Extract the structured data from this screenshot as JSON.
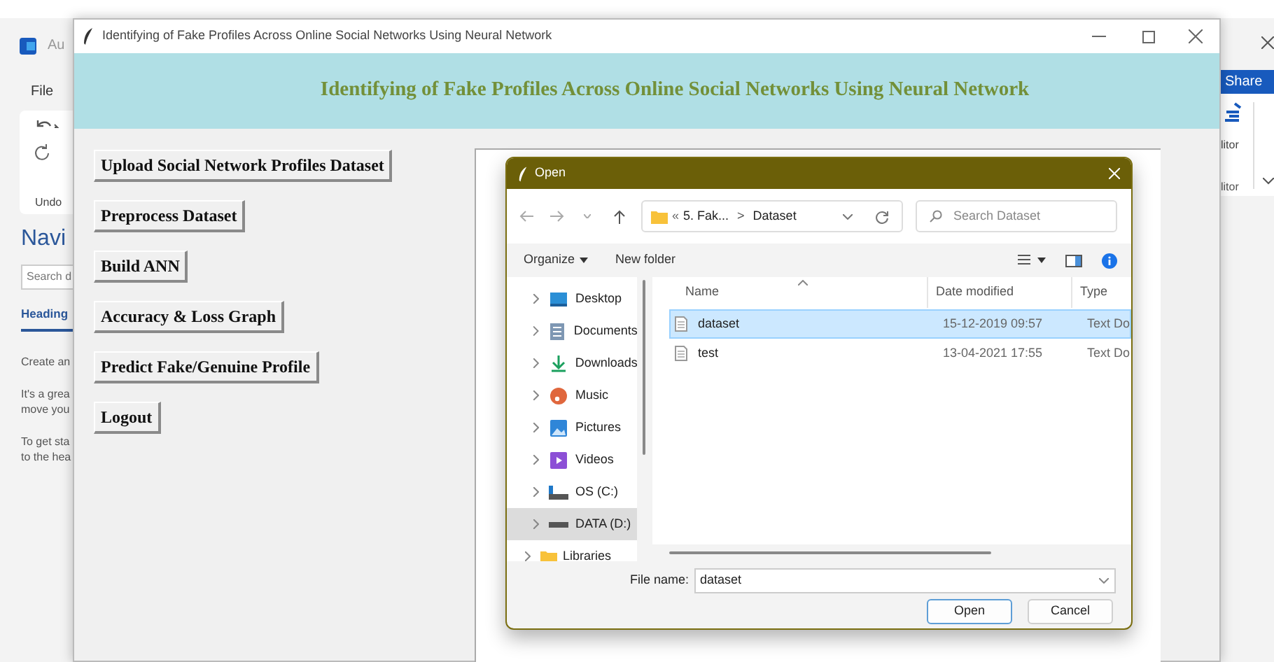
{
  "word_window": {
    "app_name": "Au",
    "menu": "File",
    "undo_label": "Undo",
    "nav_title": "Navi",
    "search_placeholder": "Search d",
    "tab": "Heading",
    "paragraphs": [
      "Create an",
      "It's a grea\nmove you",
      "To get sta\nto the hea"
    ],
    "share": "Share",
    "editor_labels": [
      "litor",
      "litor"
    ]
  },
  "app_window": {
    "title": "Identifying of Fake Profiles Across Online Social Networks Using Neural Network",
    "header": "Identifying of Fake Profiles Across Online Social Networks Using Neural Network",
    "buttons": [
      "Upload Social Network Profiles Dataset",
      "Preprocess Dataset",
      "Build ANN",
      "Accuracy & Loss Graph",
      "Predict Fake/Genuine Profile",
      "Logout"
    ]
  },
  "open_dialog": {
    "title": "Open",
    "path": {
      "prefix": "«",
      "parent": "5. Fak...",
      "separator": ">",
      "current": "Dataset"
    },
    "search_placeholder": "Search Dataset",
    "toolbar": {
      "organize": "Organize",
      "new_folder": "New folder"
    },
    "nav_pane": {
      "items": [
        {
          "label": "Desktop",
          "selected": false
        },
        {
          "label": "Documents",
          "selected": false
        },
        {
          "label": "Downloads",
          "selected": false
        },
        {
          "label": "Music",
          "selected": false
        },
        {
          "label": "Pictures",
          "selected": false
        },
        {
          "label": "Videos",
          "selected": false
        },
        {
          "label": "OS (C:)",
          "selected": false
        },
        {
          "label": "DATA (D:)",
          "selected": true
        }
      ],
      "root_items": [
        {
          "label": "Libraries",
          "selected": false
        }
      ]
    },
    "columns": [
      "Name",
      "Date modified",
      "Type"
    ],
    "rows": [
      {
        "name": "dataset",
        "date": "15-12-2019 09:57",
        "type": "Text Do",
        "selected": true
      },
      {
        "name": "test",
        "date": "13-04-2021 17:55",
        "type": "Text Do",
        "selected": false
      }
    ],
    "file_name_label": "File name:",
    "file_name": "dataset",
    "buttons": [
      "Open",
      "Cancel"
    ]
  }
}
